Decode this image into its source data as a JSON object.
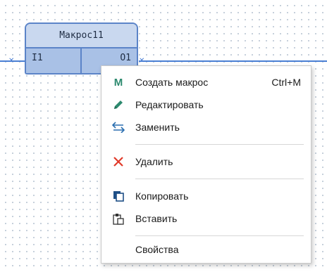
{
  "block": {
    "title": "Макрос11",
    "input_port": "I1",
    "output_port": "O1"
  },
  "context_menu": {
    "items": [
      {
        "icon": "macro-m-icon",
        "label": "Создать макрос",
        "shortcut": "Ctrl+M"
      },
      {
        "icon": "pencil-icon",
        "label": "Редактировать",
        "shortcut": ""
      },
      {
        "icon": "swap-arrows-icon",
        "label": "Заменить",
        "shortcut": ""
      },
      {
        "icon": "red-x-icon",
        "label": "Удалить",
        "shortcut": ""
      },
      {
        "icon": "copy-icon",
        "label": "Копировать",
        "shortcut": ""
      },
      {
        "icon": "paste-icon",
        "label": "Вставить",
        "shortcut": ""
      },
      {
        "icon": "",
        "label": "Свойства",
        "shortcut": ""
      }
    ],
    "macro_icon_letter": "M"
  },
  "colors": {
    "wire": "#4a7fd4",
    "block_fill": "#c6d6ee",
    "port_fill": "#a9c1e6",
    "block_border": "#5b84c8",
    "delete_icon": "#e03a2a",
    "macro_icon": "#2d8a6f"
  }
}
